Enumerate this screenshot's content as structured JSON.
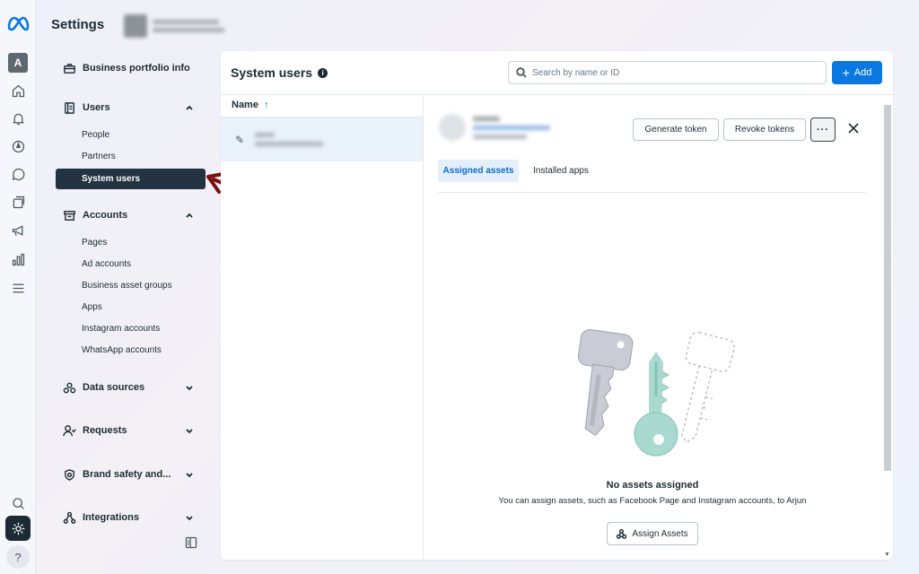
{
  "header": {
    "title": "Settings"
  },
  "rail": {
    "avatar_letter": "A",
    "help_label": "?"
  },
  "nav": {
    "business_portfolio_info": "Business portfolio info",
    "users": {
      "label": "Users",
      "items": [
        "People",
        "Partners",
        "System users"
      ],
      "active": "System users"
    },
    "accounts": {
      "label": "Accounts",
      "items": [
        "Pages",
        "Ad accounts",
        "Business asset groups",
        "Apps",
        "Instagram accounts",
        "WhatsApp accounts"
      ]
    },
    "data_sources": "Data sources",
    "requests": "Requests",
    "brand_safety": "Brand safety and...",
    "integrations": "Integrations"
  },
  "main": {
    "title": "System users",
    "search_placeholder": "Search by name or ID",
    "add_label": "Add",
    "column_name": "Name",
    "sort_arrow": "↑"
  },
  "detail": {
    "generate_token": "Generate token",
    "revoke_tokens": "Revoke tokens",
    "more_label": "···",
    "tabs": [
      "Assigned assets",
      "Installed apps"
    ],
    "empty_title": "No assets assigned",
    "empty_desc": "You can assign assets, such as Facebook Page and Instagram accounts, to Arjun",
    "assign_label": "Assign Assets"
  },
  "colors": {
    "accent": "#0a78e0",
    "active_nav": "#243341",
    "arrow": "#7a0f0f",
    "key_gray": "#c9ccd4",
    "key_teal": "#a9d9cf"
  }
}
